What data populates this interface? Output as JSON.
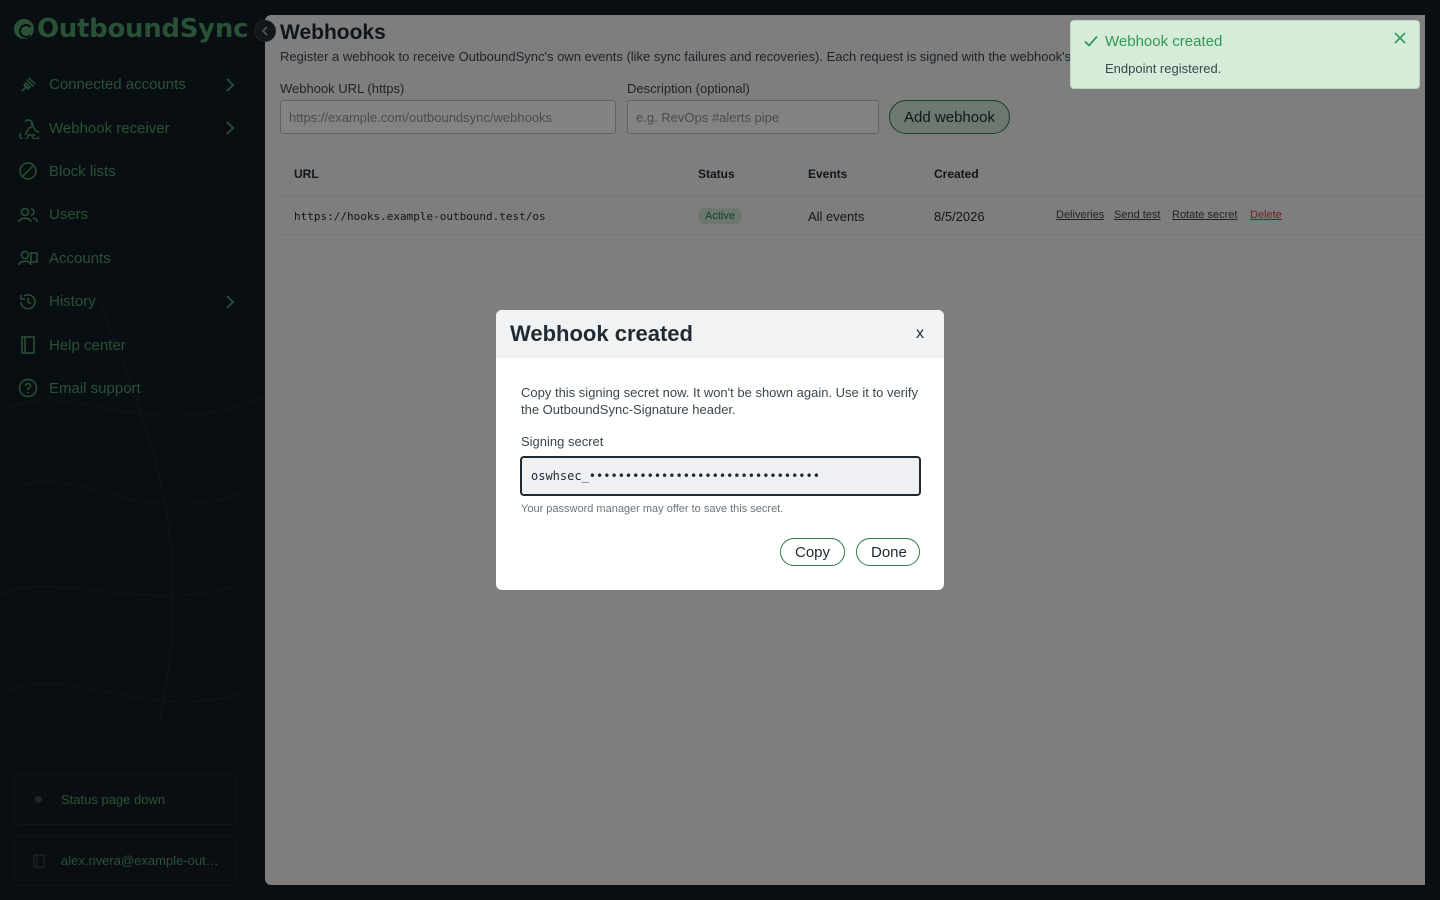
{
  "app": {
    "name": "OutboundSync"
  },
  "sidebar": {
    "items": [
      {
        "label": "Connected accounts",
        "icon": "plug-icon",
        "has_submenu": true
      },
      {
        "label": "Webhook receiver",
        "icon": "webhook-icon",
        "has_submenu": true
      },
      {
        "label": "Block lists",
        "icon": "block-icon",
        "has_submenu": false
      },
      {
        "label": "Users",
        "icon": "users-icon",
        "has_submenu": false
      },
      {
        "label": "Accounts",
        "icon": "accounts-icon",
        "has_submenu": false
      },
      {
        "label": "History",
        "icon": "history-icon",
        "has_submenu": true
      },
      {
        "label": "Help center",
        "icon": "book-icon",
        "has_submenu": false
      },
      {
        "label": "Email support",
        "icon": "help-icon",
        "has_submenu": false
      }
    ],
    "status": "Status page down",
    "user_email": "alex.rivera@example-outbound.test"
  },
  "page": {
    "title": "Webhooks",
    "description": "Register a webhook to receive OutboundSync's own events (like sync failures and recoveries). Each request is signed with the webhook's secret.",
    "url_label": "Webhook URL (https)",
    "url_placeholder": "https://example.com/outboundsync/webhooks",
    "desc_label": "Description (optional)",
    "desc_placeholder": "e.g. RevOps #alerts pipe",
    "add_button": "Add webhook"
  },
  "table": {
    "headers": {
      "url": "URL",
      "status": "Status",
      "events": "Events",
      "created": "Created"
    },
    "rows": [
      {
        "url": "https://hooks.example-outbound.test/os",
        "status": "Active",
        "events": "All events",
        "created": "8/5/2026",
        "actions": {
          "deliveries": "Deliveries",
          "send_test": "Send test",
          "rotate": "Rotate secret",
          "delete": "Delete"
        }
      }
    ]
  },
  "modal": {
    "title": "Webhook created",
    "close": "x",
    "text": "Copy this signing secret now. It won't be shown again. Use it to verify the OutboundSync-Signature header.",
    "label": "Signing secret",
    "secret_masked": "oswhsec_••••••••••••••••••••••••••••••••",
    "hint": "Your password manager may offer to save this secret.",
    "copy_button": "Copy",
    "done_button": "Done"
  },
  "toast": {
    "title": "Webhook created",
    "message": "Endpoint registered."
  },
  "colors": {
    "brand": "#4f9b68",
    "sidebar_bg": "#131b24",
    "danger": "#d33c3c",
    "toast_bg": "#d6ecd9"
  }
}
